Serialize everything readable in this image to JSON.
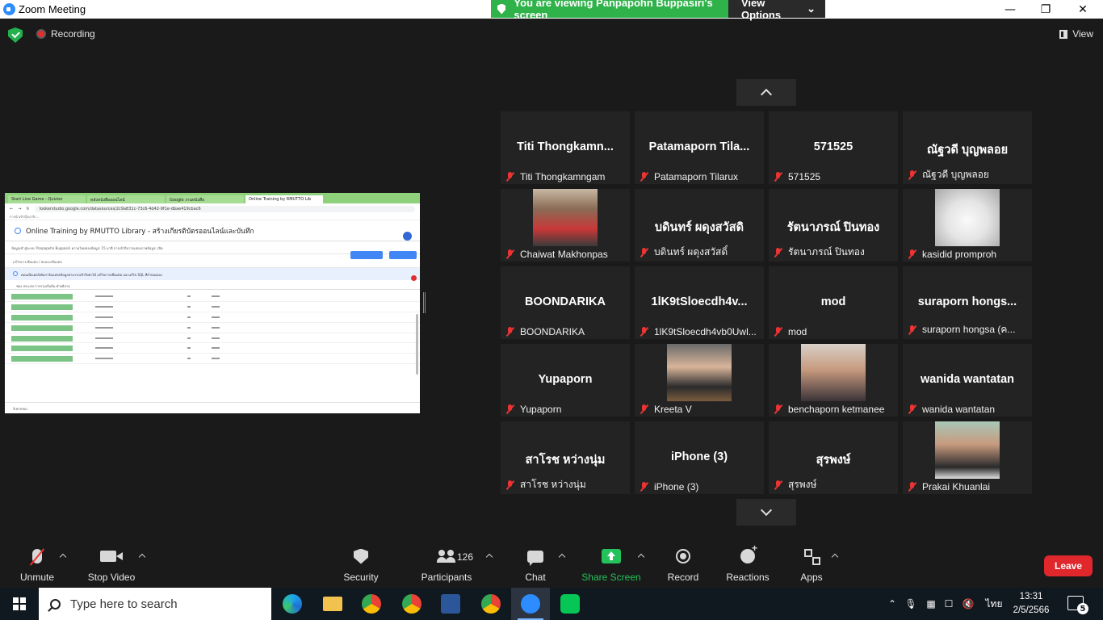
{
  "window": {
    "title": "Zoom Meeting",
    "controls": [
      "—",
      "❐",
      "✕"
    ]
  },
  "share_banner": {
    "text": "You are viewing Panpapohn Buppasiri's screen",
    "button": "View Options",
    "chevron": "⌄"
  },
  "status": {
    "recording_label": "Recording",
    "view_label": "View"
  },
  "shared_screen": {
    "tabs": [
      "Start Live Game - Quizizz",
      "คลังหนังสือออนไลน์",
      "Google งานหนังสือ",
      "Online Training by RMUTTO Lib"
    ],
    "url": "lookerstudio.google.com/datasources/2c9a831c-73c6-4d42-9f1e-dbae419cbac6",
    "bookmarks": "การนำเข้าบุ๊กมาร์ก...",
    "doc_title": "Online Training by RMUTTO Library - สร้างเกียรติบัตรออนไลน์และบันทึก",
    "toolbar": "ข้อมูลเข้าสู่ระบบ: Panpapohn Buppasiri     ความใหม่ของข้อมูล: 15 นาที     การเข้าถึงการแสดงภาพข้อมูล: เปิด",
    "crumbs": "แก้ไขการเชื่อมต่อ   /   ทดลองเชื่อมต่อ",
    "info": "คอนเน็กเตอร์เดิมการ์ดแหล่งข้อมูลสามารถเข้าถึงค่าได้ แก้ไขการเชื่อมต่อ และแก้ไข SQL ที่กำหนดเอง",
    "columns": "ช่อง     ประเภท     การรวมเริ่มต้น     คำอธิบาย",
    "footer": "รีเฟรชช่อง",
    "row_count": 7
  },
  "gallery": {
    "tiles": [
      {
        "big": "Titi  Thongkamn...",
        "caption": "Titi Thongkamngam"
      },
      {
        "big": "Patamaporn  Tila...",
        "caption": "Patamaporn Tilarux"
      },
      {
        "big": "571525",
        "caption": "571525"
      },
      {
        "big": "ณัฐวดี บุญพลอย",
        "caption": "ณัฐวดี บุญพลอย"
      },
      {
        "big": "",
        "caption": "Chaiwat Makhonpas",
        "photo": "p1"
      },
      {
        "big": "บดินทร์ ผดุงสวัสดิ",
        "caption": "บดินทร์ ผดุงสวัสดิ์"
      },
      {
        "big": "รัตนาภรณ์ ปินทอง",
        "caption": "รัตนาภรณ์ ปินทอง"
      },
      {
        "big": "",
        "caption": "kasidid promproh",
        "photo": "p2"
      },
      {
        "big": "BOONDARIKA",
        "caption": "BOONDARIKA"
      },
      {
        "big": "1lK9tSloecdh4v...",
        "caption": "1lK9tSloecdh4vb0Uwl..."
      },
      {
        "big": "mod",
        "caption": "mod"
      },
      {
        "big": "suraporn  hongs...",
        "caption": "suraporn hongsa (ค..."
      },
      {
        "big": "Yupaporn",
        "caption": "Yupaporn"
      },
      {
        "big": "",
        "caption": "Kreeta V",
        "photo": "p3"
      },
      {
        "big": "",
        "caption": "benchaporn ketmanee",
        "photo": "p4"
      },
      {
        "big": "wanida wantatan",
        "caption": "wanida wantatan"
      },
      {
        "big": "สาโรช หว่างนุ่ม",
        "caption": "สาโรช หว่างนุ่ม"
      },
      {
        "big": "iPhone (3)",
        "caption": "iPhone (3)"
      },
      {
        "big": "สุรพงษ์",
        "caption": "สุรพงษ์"
      },
      {
        "big": "",
        "caption": "Prakai Khuanlai",
        "photo": "p5"
      }
    ]
  },
  "toolbar": {
    "unmute": "Unmute",
    "stop_video": "Stop Video",
    "security": "Security",
    "participants": "Participants",
    "participants_count": "126",
    "chat": "Chat",
    "share_screen": "Share Screen",
    "record": "Record",
    "reactions": "Reactions",
    "apps": "Apps",
    "leave": "Leave"
  },
  "taskbar": {
    "search_placeholder": "Type here to search",
    "lang": "ไทย",
    "time": "13:31",
    "date": "2/5/2566",
    "notifications": "5"
  },
  "colors": {
    "zoom_blue": "#2d8cff",
    "banner_green": "#2fb24a",
    "share_green": "#23c25a",
    "leave_red": "#e0272c",
    "muted_red": "#e33333"
  }
}
